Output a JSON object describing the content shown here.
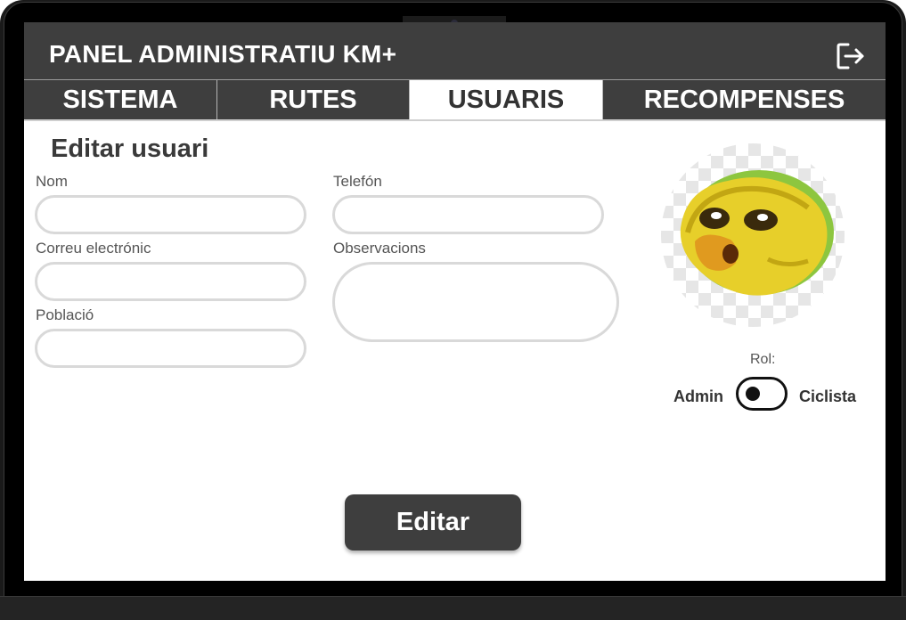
{
  "header": {
    "title": "PANEL ADMINISTRATIU KM+",
    "logout_icon": "logout-icon"
  },
  "tabs": [
    {
      "label": "SISTEMA",
      "active": false
    },
    {
      "label": "RUTES",
      "active": false
    },
    {
      "label": "USUARIS",
      "active": true
    },
    {
      "label": "RECOMPENSES",
      "active": false
    }
  ],
  "form": {
    "title": "Editar usuari",
    "fields": {
      "nom": {
        "label": "Nom",
        "value": ""
      },
      "telefon": {
        "label": "Telefón",
        "value": ""
      },
      "correu": {
        "label": "Correu electrónic",
        "value": ""
      },
      "observacions": {
        "label": "Observacions",
        "value": ""
      },
      "poblacio": {
        "label": "Població",
        "value": ""
      }
    },
    "role": {
      "label": "Rol:",
      "option_left": "Admin",
      "option_right": "Ciclista",
      "selected": "Admin"
    },
    "submit_label": "Editar"
  },
  "avatar": {
    "icon": "user-avatar-image"
  },
  "colors": {
    "header_bg": "#3e3e3e",
    "active_tab_bg": "#ffffff",
    "field_border": "#d9d9d9",
    "button_bg": "#3e3e3e"
  }
}
